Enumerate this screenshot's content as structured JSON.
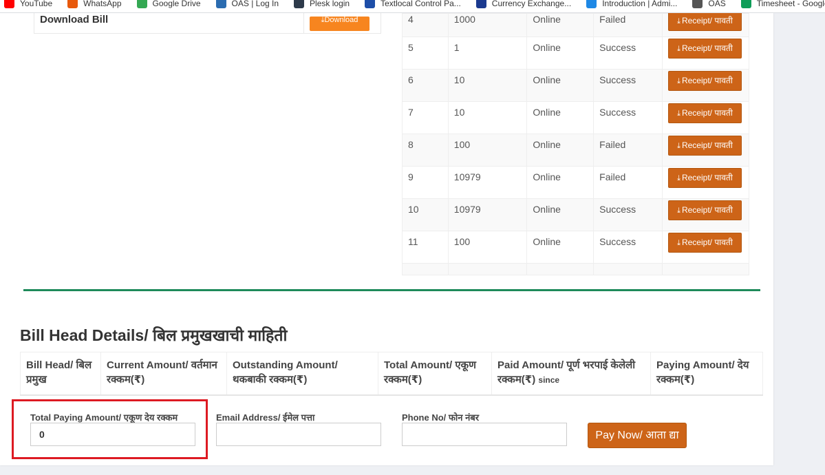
{
  "bookmarks": [
    {
      "label": "YouTube",
      "icon": "youtube-icon",
      "color": "#ff0000"
    },
    {
      "label": "WhatsApp",
      "icon": "whatsapp-icon",
      "color": "#e8590c"
    },
    {
      "label": "Google Drive",
      "icon": "google-drive-icon",
      "color": "#34a853"
    },
    {
      "label": "OAS | Log In",
      "icon": "oas-icon",
      "color": "#2b6cb0"
    },
    {
      "label": "Plesk login",
      "icon": "plesk-icon",
      "color": "#2d3a4a"
    },
    {
      "label": "Textlocal Control Pa...",
      "icon": "textlocal-icon",
      "color": "#1d4ea8"
    },
    {
      "label": "Currency Exchange...",
      "icon": "xe-icon",
      "color": "#1b3a8f"
    },
    {
      "label": "Introduction | Admi...",
      "icon": "admin-icon",
      "color": "#1e88e5"
    },
    {
      "label": "OAS",
      "icon": "oas-globe-icon",
      "color": "#555555"
    },
    {
      "label": "Timesheet - Google...",
      "icon": "sheets-icon",
      "color": "#0f9d58"
    },
    {
      "label": "",
      "icon": "purple-icon",
      "color": "#5b2a86"
    }
  ],
  "download_bill": {
    "label": "Download Bill",
    "button": "Download",
    "button_icon": "download-icon"
  },
  "payments": {
    "receipt_label": "Receipt/ पावती",
    "rows": [
      {
        "no": "4",
        "amount": "1000",
        "mode": "Online",
        "status": "Failed"
      },
      {
        "no": "5",
        "amount": "1",
        "mode": "Online",
        "status": "Success"
      },
      {
        "no": "6",
        "amount": "10",
        "mode": "Online",
        "status": "Success"
      },
      {
        "no": "7",
        "amount": "10",
        "mode": "Online",
        "status": "Success"
      },
      {
        "no": "8",
        "amount": "100",
        "mode": "Online",
        "status": "Failed"
      },
      {
        "no": "9",
        "amount": "10979",
        "mode": "Online",
        "status": "Failed"
      },
      {
        "no": "10",
        "amount": "10979",
        "mode": "Online",
        "status": "Success"
      },
      {
        "no": "11",
        "amount": "100",
        "mode": "Online",
        "status": "Success"
      }
    ]
  },
  "bill_head": {
    "title": "Bill Head Details/ बिल प्रमुखखाची माहिती",
    "columns": [
      {
        "label": "Bill Head/ बिल प्रमुख",
        "suffix": ""
      },
      {
        "label": "Current Amount/ वर्तमान रक्कम(₹)",
        "suffix": ""
      },
      {
        "label": "Outstanding Amount/ थकबाकी रक्कम(₹)",
        "suffix": ""
      },
      {
        "label": "Total Amount/ एकूण रक्कम(₹)",
        "suffix": ""
      },
      {
        "label": "Paid Amount/ पूर्ण भरपाई केलेली रक्कम(₹)",
        "suffix": "since"
      },
      {
        "label": "Paying Amount/ देय रक्कम(₹)",
        "suffix": ""
      }
    ]
  },
  "form": {
    "total_label": "Total Paying Amount/ एकूण देय रक्कम",
    "total_value": "0",
    "email_label": "Email Address/ ईमेल पत्ता",
    "email_value": "",
    "phone_label": "Phone No/ फोन नंबर",
    "phone_value": "",
    "pay_now": "Pay Now/ आता द्या"
  },
  "colors": {
    "accent": "#cd6418",
    "download": "#f7851f",
    "divider": "#1e8a5a",
    "highlight": "#dd1a22"
  }
}
